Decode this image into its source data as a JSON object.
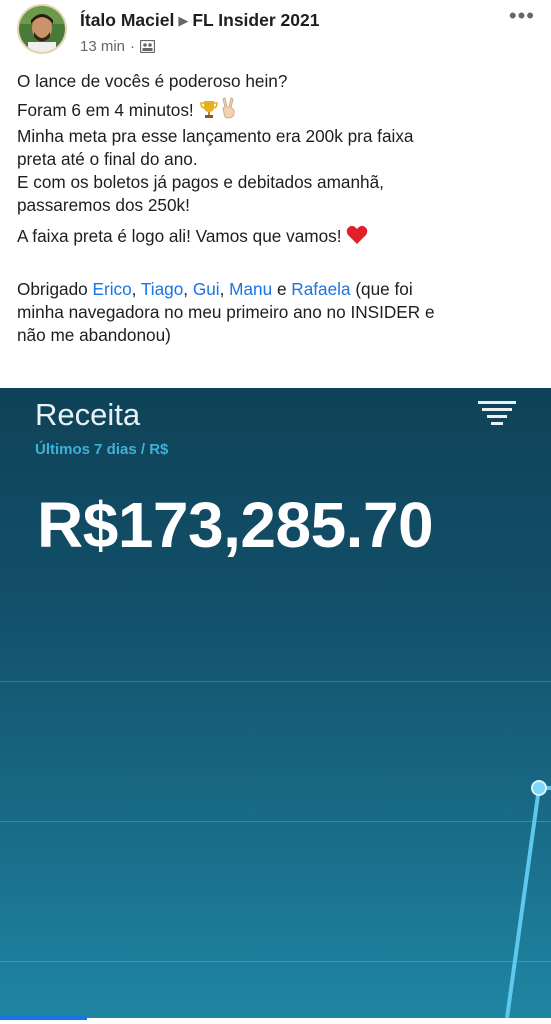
{
  "post": {
    "author": "Ítalo Maciel",
    "group": "FL Insider 2021",
    "time": "13 min",
    "separator": "·",
    "group_icon": "group-icon",
    "more_icon": "more-icon",
    "lines": {
      "l1": "O lance de vocês é poderoso hein?",
      "l2": "Foram 6 em 4 minutos!",
      "l3": "Minha meta pra esse lançamento era 200k pra faixa",
      "l4": "preta até o final do ano.",
      "l5": "E com os boletos já pagos e debitados amanhã,",
      "l6": "passaremos dos 250k!",
      "l7": "A faixa preta é logo ali! Vamos que vamos!"
    },
    "emojis": [
      "trophy-icon",
      "victory-hand-icon",
      "heart-icon"
    ],
    "thanks": {
      "prefix": "Obrigado",
      "comma": ",",
      "and": "e",
      "mentions": [
        "Erico",
        "Tiago",
        "Gui",
        "Manu",
        "Rafaela"
      ],
      "suffix1": "(que foi",
      "line2": "minha navegadora no meu primeiro ano no INSIDER e",
      "line3": "não me abandonou)"
    }
  },
  "dashboard": {
    "title": "Receita",
    "subtitle": "Últimos 7 dias / R$",
    "value": "R$173,285.70",
    "menu_icon": "filter-menu-icon",
    "colors": {
      "accent": "#3fb0d8",
      "line": "#5fc8ee",
      "bg_top": "#0f4258",
      "bg_bottom": "#1f86a3",
      "link": "#1b74e4"
    }
  }
}
